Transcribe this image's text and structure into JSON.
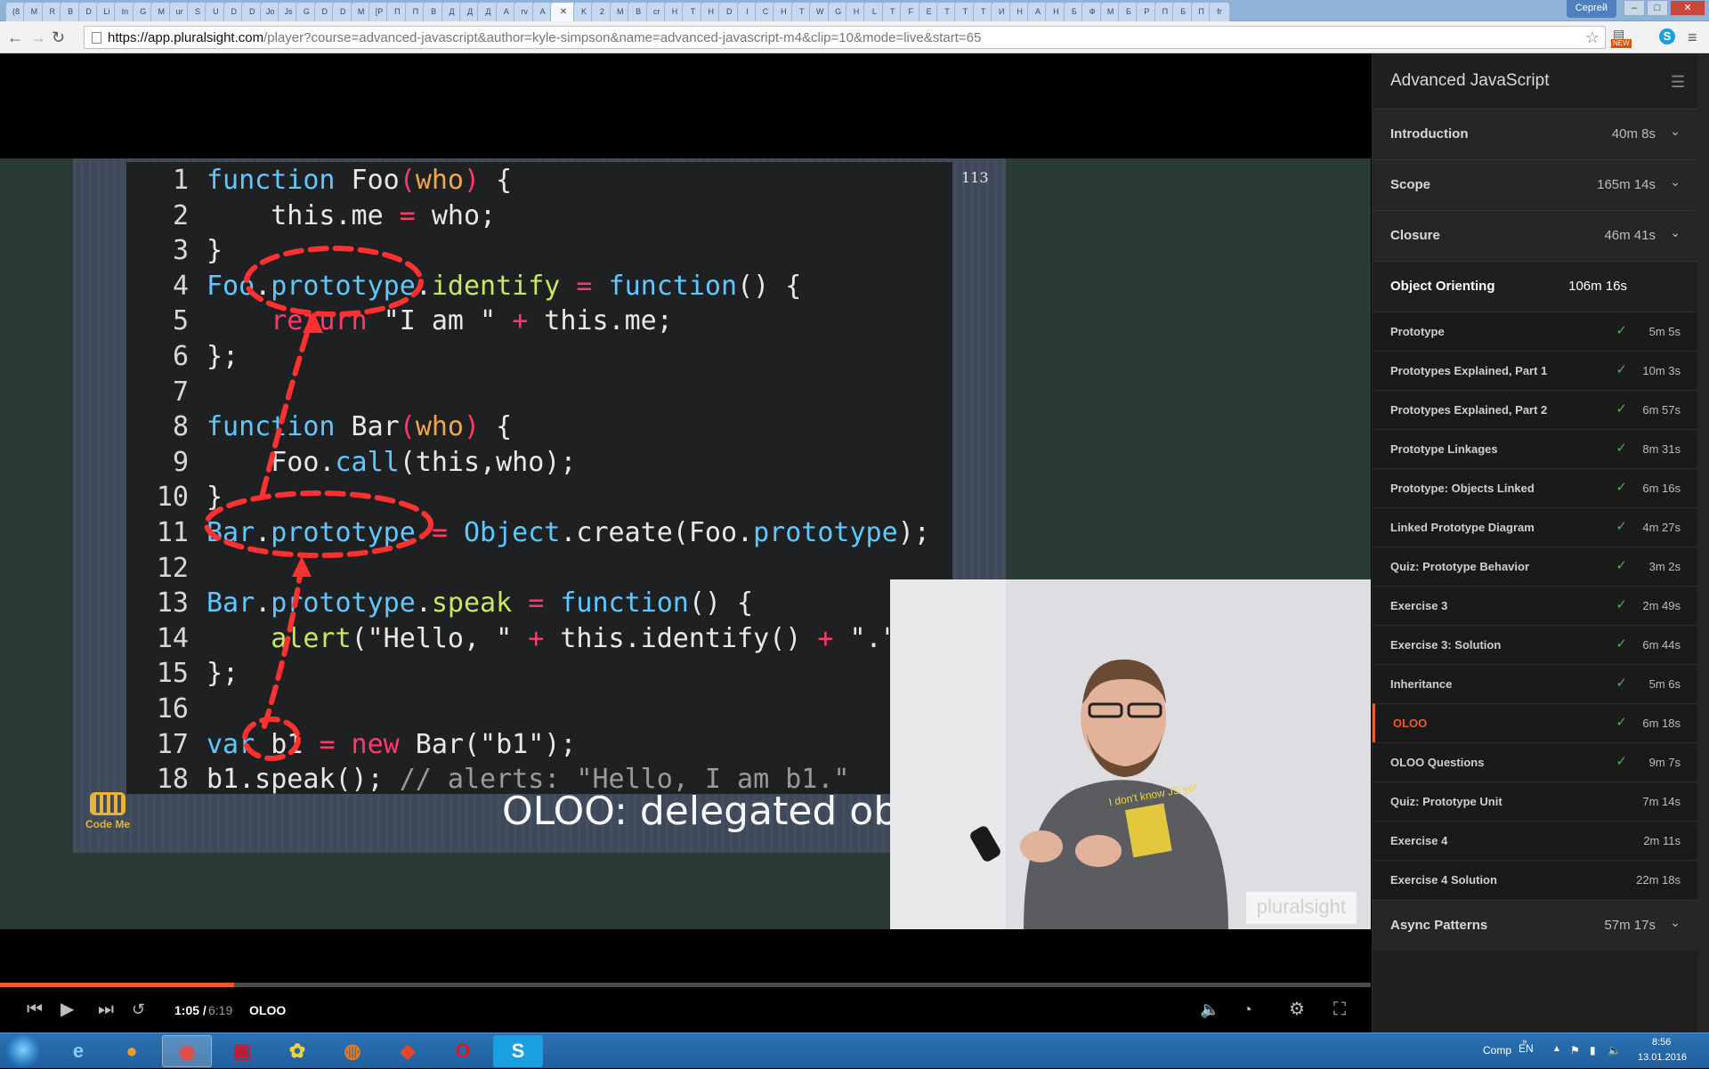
{
  "browser": {
    "url_host": "https://app.pluralsight.com",
    "url_rest": "/player?course=advanced-javascript&author=kyle-simpson&name=advanced-javascript-m4&clip=10&mode=live&start=65",
    "user_label": "Сергей",
    "new_badge": "NEW",
    "tab_letters": [
      "(8",
      "M",
      "R",
      "B",
      "D",
      "Li",
      "In",
      "G",
      "M",
      "ur",
      "S",
      "U",
      "D",
      "D",
      "Jo",
      "Js",
      "G",
      "D",
      "D",
      "M",
      "[P",
      "П",
      "П",
      "В",
      "Д",
      "Д",
      "Д",
      "А",
      "rv",
      "А",
      "",
      "K",
      "2",
      "M",
      "B",
      "cr",
      "H",
      "T",
      "H",
      "D",
      "I",
      "C",
      "H",
      "T",
      "W",
      "G",
      "H",
      "L",
      "T",
      "F",
      "E",
      "T",
      "T",
      "T",
      "И",
      "H",
      "A",
      "H",
      "Б",
      "Ф",
      "M",
      "Б",
      "P",
      "П",
      "Б",
      "П",
      "fr"
    ]
  },
  "slide": {
    "number": "113",
    "title": "OLOO: delegated objects",
    "logo_label": "Code Me",
    "code_lines": [
      {
        "n": "1",
        "tokens": [
          [
            "kw",
            "function"
          ],
          [
            "fn",
            " Foo"
          ],
          [
            "op",
            "("
          ],
          [
            "param",
            "who"
          ],
          [
            "op",
            ")"
          ],
          [
            "fn",
            " {"
          ]
        ]
      },
      {
        "n": "2",
        "tokens": [
          [
            "fn",
            "    this.me "
          ],
          [
            "op",
            "="
          ],
          [
            "fn",
            " who;"
          ]
        ]
      },
      {
        "n": "3",
        "tokens": [
          [
            "fn",
            "}"
          ]
        ]
      },
      {
        "n": "4",
        "tokens": [
          [
            "prop",
            "Foo"
          ],
          [
            "fn",
            "."
          ],
          [
            "prop",
            "prototype"
          ],
          [
            "fn",
            "."
          ],
          [
            "meth",
            "identify"
          ],
          [
            "op",
            " = "
          ],
          [
            "kw",
            "function"
          ],
          [
            "fn",
            "() {"
          ]
        ]
      },
      {
        "n": "5",
        "tokens": [
          [
            "new",
            "    return"
          ],
          [
            "str",
            " \"I am \" "
          ],
          [
            "op",
            "+"
          ],
          [
            "fn",
            " this.me;"
          ]
        ]
      },
      {
        "n": "6",
        "tokens": [
          [
            "fn",
            "};"
          ]
        ]
      },
      {
        "n": "7",
        "tokens": [
          [
            "fn",
            ""
          ]
        ]
      },
      {
        "n": "8",
        "tokens": [
          [
            "kw",
            "function"
          ],
          [
            "fn",
            " Bar"
          ],
          [
            "op",
            "("
          ],
          [
            "param",
            "who"
          ],
          [
            "op",
            ")"
          ],
          [
            "fn",
            " {"
          ]
        ]
      },
      {
        "n": "9",
        "tokens": [
          [
            "fn",
            "    Foo."
          ],
          [
            "prop",
            "call"
          ],
          [
            "fn",
            "(this,who);"
          ]
        ]
      },
      {
        "n": "10",
        "tokens": [
          [
            "fn",
            "}"
          ]
        ]
      },
      {
        "n": "11",
        "tokens": [
          [
            "prop",
            "Bar"
          ],
          [
            "fn",
            "."
          ],
          [
            "prop",
            "prototype"
          ],
          [
            "op",
            " = "
          ],
          [
            "prop",
            "Object"
          ],
          [
            "fn",
            ".create(Foo."
          ],
          [
            "prop",
            "prototype"
          ],
          [
            "fn",
            ");"
          ]
        ]
      },
      {
        "n": "12",
        "tokens": [
          [
            "fn",
            ""
          ]
        ]
      },
      {
        "n": "13",
        "tokens": [
          [
            "prop",
            "Bar"
          ],
          [
            "fn",
            "."
          ],
          [
            "prop",
            "prototype"
          ],
          [
            "fn",
            "."
          ],
          [
            "meth",
            "speak"
          ],
          [
            "op",
            " = "
          ],
          [
            "kw",
            "function"
          ],
          [
            "fn",
            "() {"
          ]
        ]
      },
      {
        "n": "14",
        "tokens": [
          [
            "meth",
            "    alert"
          ],
          [
            "fn",
            "(\"Hello, \" "
          ],
          [
            "op",
            "+"
          ],
          [
            "fn",
            " this.identify() "
          ],
          [
            "op",
            "+"
          ],
          [
            "fn",
            " \".\");"
          ]
        ]
      },
      {
        "n": "15",
        "tokens": [
          [
            "fn",
            "};"
          ]
        ]
      },
      {
        "n": "16",
        "tokens": [
          [
            "fn",
            ""
          ]
        ]
      },
      {
        "n": "17",
        "tokens": [
          [
            "kw",
            "var"
          ],
          [
            "fn",
            " b1 "
          ],
          [
            "op",
            "="
          ],
          [
            "new",
            " new"
          ],
          [
            "fn",
            " Bar(\"b1\");"
          ]
        ]
      },
      {
        "n": "18",
        "tokens": [
          [
            "fn",
            "b1.speak(); "
          ],
          [
            "com",
            "// alerts: \"Hello, I am b1.\""
          ]
        ]
      }
    ]
  },
  "video": {
    "watermark": "pluralsight",
    "shirt_text": "I don't know JS yet"
  },
  "controls": {
    "time_current": "1:05 /",
    "time_total": "6:19",
    "clip_title": "OLOO",
    "progress_fraction": 0.171
  },
  "sidebar": {
    "course_title": "Advanced JavaScript",
    "modules_before": [
      {
        "title": "Introduction",
        "duration": "40m 8s"
      },
      {
        "title": "Scope",
        "duration": "165m 14s"
      },
      {
        "title": "Closure",
        "duration": "46m 41s"
      }
    ],
    "open_module": {
      "title": "Object Orienting",
      "duration": "106m 16s"
    },
    "clips": [
      {
        "title": "Prototype",
        "duration": "5m 5s",
        "done": true
      },
      {
        "title": "Prototypes Explained, Part 1",
        "duration": "10m 3s",
        "done": true
      },
      {
        "title": "Prototypes Explained, Part 2",
        "duration": "6m 57s",
        "done": true
      },
      {
        "title": "Prototype Linkages",
        "duration": "8m 31s",
        "done": true
      },
      {
        "title": "Prototype: Objects Linked",
        "duration": "6m 16s",
        "done": true
      },
      {
        "title": "Linked Prototype Diagram",
        "duration": "4m 27s",
        "done": true
      },
      {
        "title": "Quiz: Prototype Behavior",
        "duration": "3m 2s",
        "done": true
      },
      {
        "title": "Exercise 3",
        "duration": "2m 49s",
        "done": true
      },
      {
        "title": "Exercise 3: Solution",
        "duration": "6m 44s",
        "done": true
      },
      {
        "title": "Inheritance",
        "duration": "5m 6s",
        "done": true
      },
      {
        "title": "OLOO",
        "duration": "6m 18s",
        "done": true,
        "current": true
      },
      {
        "title": "OLOO Questions",
        "duration": "9m 7s",
        "done": true
      },
      {
        "title": "Quiz: Prototype Unit",
        "duration": "7m 14s",
        "done": false
      },
      {
        "title": "Exercise 4",
        "duration": "2m 11s",
        "done": false
      },
      {
        "title": "Exercise 4 Solution",
        "duration": "22m 18s",
        "done": false
      }
    ],
    "modules_after": [
      {
        "title": "Async Patterns",
        "duration": "57m 17s"
      }
    ]
  },
  "taskbar": {
    "lang": "EN",
    "comp_label": "Comp",
    "time": "8:56",
    "date": "13.01.2016"
  },
  "colors": {
    "accent": "#f05a28",
    "check": "#4fae5b"
  }
}
